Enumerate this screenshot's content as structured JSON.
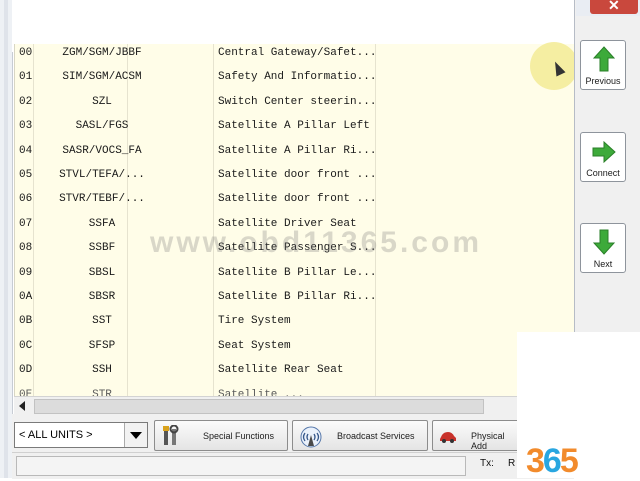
{
  "modules": [
    {
      "id": "00",
      "abbr": "ZGM/SGM/JBBF",
      "desc": "Central Gateway/Safet..."
    },
    {
      "id": "01",
      "abbr": "SIM/SGM/ACSM",
      "desc": "Safety And Informatio..."
    },
    {
      "id": "02",
      "abbr": "SZL",
      "desc": "Switch Center steerin..."
    },
    {
      "id": "03",
      "abbr": "SASL/FGS",
      "desc": "Satellite A Pillar Left"
    },
    {
      "id": "04",
      "abbr": "SASR/VOCS_FA",
      "desc": "Satellite A Pillar Ri..."
    },
    {
      "id": "05",
      "abbr": "STVL/TEFA/...",
      "desc": "Satellite door front ..."
    },
    {
      "id": "06",
      "abbr": "STVR/TEBF/...",
      "desc": "Satellite door front ..."
    },
    {
      "id": "07",
      "abbr": "SSFA",
      "desc": "Satellite Driver Seat"
    },
    {
      "id": "08",
      "abbr": "SSBF",
      "desc": "Satellite Passenger S..."
    },
    {
      "id": "09",
      "abbr": "SBSL",
      "desc": "Satellite B Pillar Le..."
    },
    {
      "id": "0A",
      "abbr": "SBSR",
      "desc": "Satellite B Pillar Ri..."
    },
    {
      "id": "0B",
      "abbr": "SST",
      "desc": "Tire System"
    },
    {
      "id": "0C",
      "abbr": "SFSP",
      "desc": "Seat System"
    },
    {
      "id": "0D",
      "abbr": "SSH",
      "desc": "Satellite Rear Seat"
    },
    {
      "id": "0E",
      "abbr": "STR",
      "desc": "Satellite ..."
    }
  ],
  "side_buttons": {
    "previous": "Previous",
    "connect": "Connect",
    "next": "Next"
  },
  "toolbar": {
    "unit_select_value": "< ALL UNITS >",
    "special_functions": "Special Functions",
    "broadcast_services": "Broadcast Services",
    "physical_addressing": "Physical Add"
  },
  "status": {
    "tx": "Tx:",
    "rx": "R"
  },
  "watermark": "www.obd11365.com",
  "logo": {
    "left": "3",
    "six": "6",
    "right": "5"
  },
  "colors": {
    "list_background": "#fffde8",
    "arrow_green": "#3daa3a",
    "logo_orange": "#f28b2c",
    "logo_blue": "#29a6e0"
  },
  "icons": {
    "previous": "green-up-arrow-icon",
    "connect": "green-right-arrow-icon",
    "next": "green-down-arrow-icon",
    "special_functions": "wrench-screwdriver-icon",
    "broadcast_services": "broadcast-antenna-icon",
    "physical_addressing": "car-icon"
  }
}
